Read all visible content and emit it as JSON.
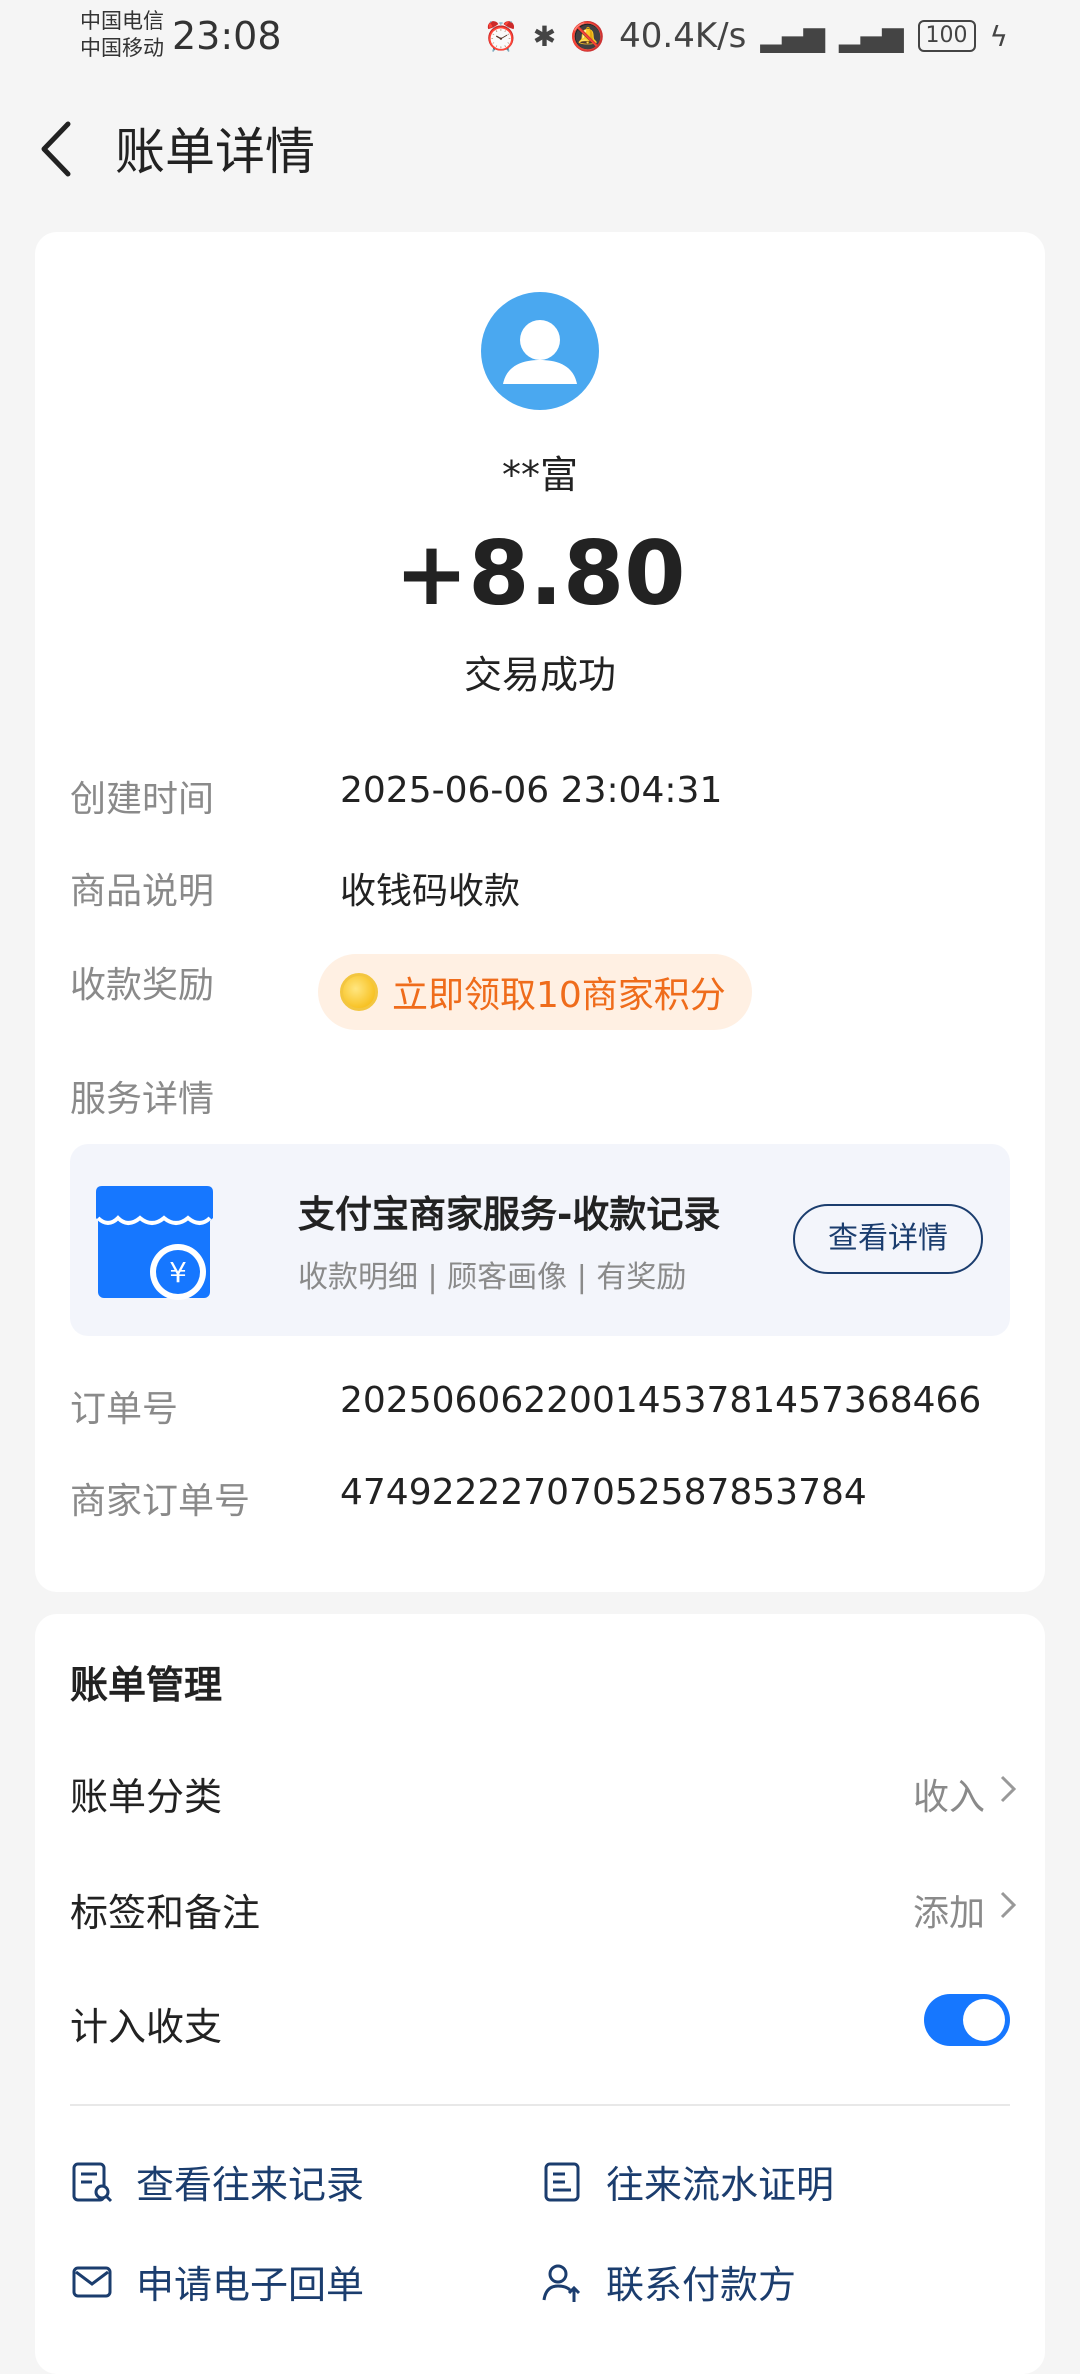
{
  "status_bar": {
    "carrier1": "中国电信",
    "carrier2": "中国移动",
    "time": "23:08",
    "speed": "40.4K/s",
    "battery": "100"
  },
  "header": {
    "title": "账单详情"
  },
  "bill": {
    "payer_name": "**富",
    "amount": "+8.80",
    "status": "交易成功",
    "rows": {
      "created_label": "创建时间",
      "created_value": "2025-06-06 23:04:31",
      "desc_label": "商品说明",
      "desc_value": "收钱码收款",
      "reward_label": "收款奖励",
      "reward_value": "立即领取10商家积分",
      "service_label": "服务详情",
      "order_label": "订单号",
      "order_value": "2025060622001453781457368466",
      "merchant_order_label": "商家订单号",
      "merchant_order_value": "47492222707052587853784"
    },
    "service": {
      "title": "支付宝商家服务-收款记录",
      "subtitle": "收款明细 | 顾客画像 | 有奖励",
      "button": "查看详情"
    }
  },
  "management": {
    "title": "账单管理",
    "category_label": "账单分类",
    "category_value": "收入",
    "tag_label": "标签和备注",
    "tag_value": "添加",
    "include_label": "计入收支",
    "include_on": true,
    "links": [
      "查看往来记录",
      "往来流水证明",
      "申请电子回单",
      "联系付款方"
    ]
  },
  "colors": {
    "accent": "#1677ff",
    "link": "#1b3d6e",
    "reward": "#ef6c1b",
    "avatar": "#4aa8f0"
  }
}
